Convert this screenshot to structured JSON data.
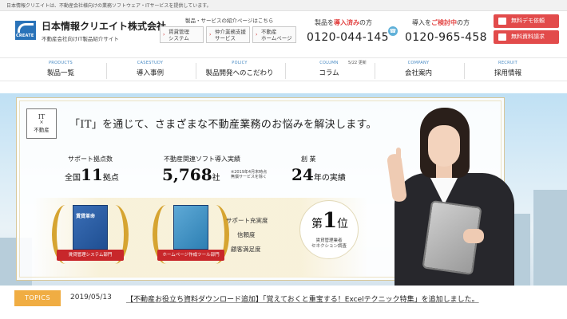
{
  "topbar": {
    "text": "日本情報クリエイトは、不動産会社様向けの業務ソフトウェア・ITサービスを提供しています。"
  },
  "header": {
    "logo_text": "CREATE",
    "company_name": "日本情報クリエイト株式会社",
    "company_sub": "不動産会社向けIT製品紹介サイト",
    "services_title": "製品・サービスの紹介ページはこちら",
    "services": [
      {
        "line1": "賃貸管理",
        "line2": "システム"
      },
      {
        "line1": "仲介業務支援",
        "line2": "サービス"
      },
      {
        "line1": "不動産",
        "line2": "ホームページ"
      }
    ],
    "tel": [
      {
        "pre": "製品を",
        "highlight": "導入済み",
        "post": "の方",
        "number": "0120-044-145"
      },
      {
        "pre": "導入を",
        "highlight": "ご検討中",
        "post": "の方",
        "number": "0120-965-458"
      }
    ],
    "buttons": {
      "demo": "無料デモ依頼",
      "docs": "無料資料請求"
    }
  },
  "nav": {
    "badge": "5/22 更新",
    "items": [
      {
        "en": "PRODUCTS",
        "jp": "製品一覧"
      },
      {
        "en": "CASESTUDY",
        "jp": "導入事例"
      },
      {
        "en": "POLICY",
        "jp": "製品開発へのこだわり"
      },
      {
        "en": "COLUMN",
        "jp": "コラム"
      },
      {
        "en": "COMPANY",
        "jp": "会社案内"
      },
      {
        "en": "RECRUIT",
        "jp": "採用情報"
      }
    ]
  },
  "hero": {
    "it_box": {
      "top": "IT",
      "mid": "×",
      "bottom": "不動産"
    },
    "headline": "「IT」を通じて、さまざまな不動産業務のお悩みを解決します。",
    "stats": [
      {
        "label": "サポート拠点数",
        "pre": "全国",
        "value": "11",
        "post": "拠点"
      },
      {
        "label": "不動産関連ソフト導入実績",
        "pre": "",
        "value": "5,768",
        "post": "社"
      },
      {
        "label": "創 業",
        "pre": "",
        "value": "24",
        "post": "年の実績"
      }
    ],
    "stat_note": [
      "※2019年4月末時点",
      "無償サービスを除く"
    ],
    "awards": [
      {
        "product": "賃貸革命",
        "ribbon": "賃貸管理システム部門"
      },
      {
        "product": "",
        "ribbon": "ホームページ作成ツール部門"
      }
    ],
    "satisfaction": [
      "サポート充実度",
      "信頼度",
      "顧客満足度"
    ],
    "rank": {
      "pre": "第",
      "value": "1",
      "post": "位"
    },
    "rank_note": [
      "賃貸管理業者",
      "セネクション調査"
    ]
  },
  "topics": {
    "badge": "TOPICS",
    "date": "2019/05/13",
    "text": "【不動産お役立ち資料ダウンロード追加】「覚えておくと重宝する！Excelテクニック特集」を追加しました。"
  }
}
